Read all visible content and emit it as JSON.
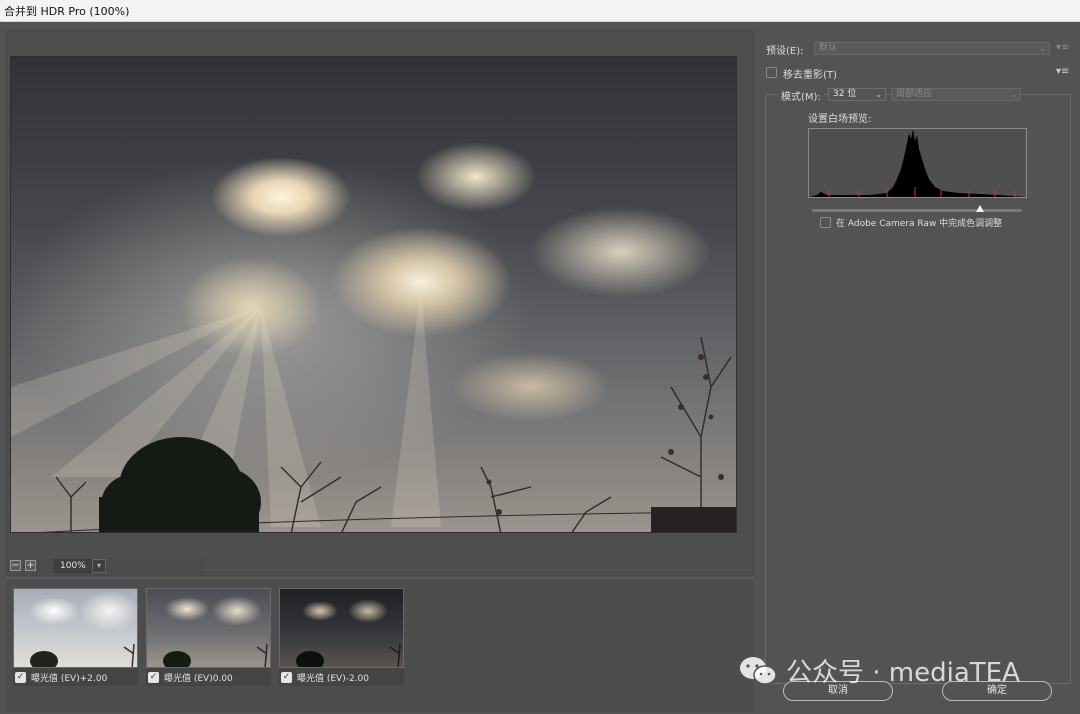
{
  "window": {
    "title": "合并到 HDR Pro (100%)"
  },
  "zoom": {
    "minus": "−",
    "plus": "+",
    "value": "100%"
  },
  "thumbnails": [
    {
      "caption": "曝光值 (EV)+2.00",
      "checked": true,
      "tone": "bright"
    },
    {
      "caption": "曝光值 (EV)0.00",
      "checked": true,
      "tone": "mid"
    },
    {
      "caption": "曝光值 (EV)-2.00",
      "checked": true,
      "tone": "dark"
    }
  ],
  "panel": {
    "preset_label": "预设(E):",
    "preset_value": "默认",
    "remove_ghosts_label": "移去重影(T)",
    "mode_label": "模式(M):",
    "bit_depth": "32 位",
    "method": "局部适应",
    "white_point_label": "设置白场预览:",
    "acr_label": "在 Adobe Camera Raw 中完成色调调整"
  },
  "buttons": {
    "cancel": "取消",
    "ok": "确定"
  },
  "watermark": {
    "text": "公众号 · mediaTEA"
  },
  "colors": {
    "bg": "#535353",
    "panel": "#4e4e4e",
    "text": "#dedede",
    "disabled": "#8c8c8c"
  },
  "icons": {
    "panel_menu": "flyout-menu-icon",
    "wechat": "wechat-icon"
  }
}
